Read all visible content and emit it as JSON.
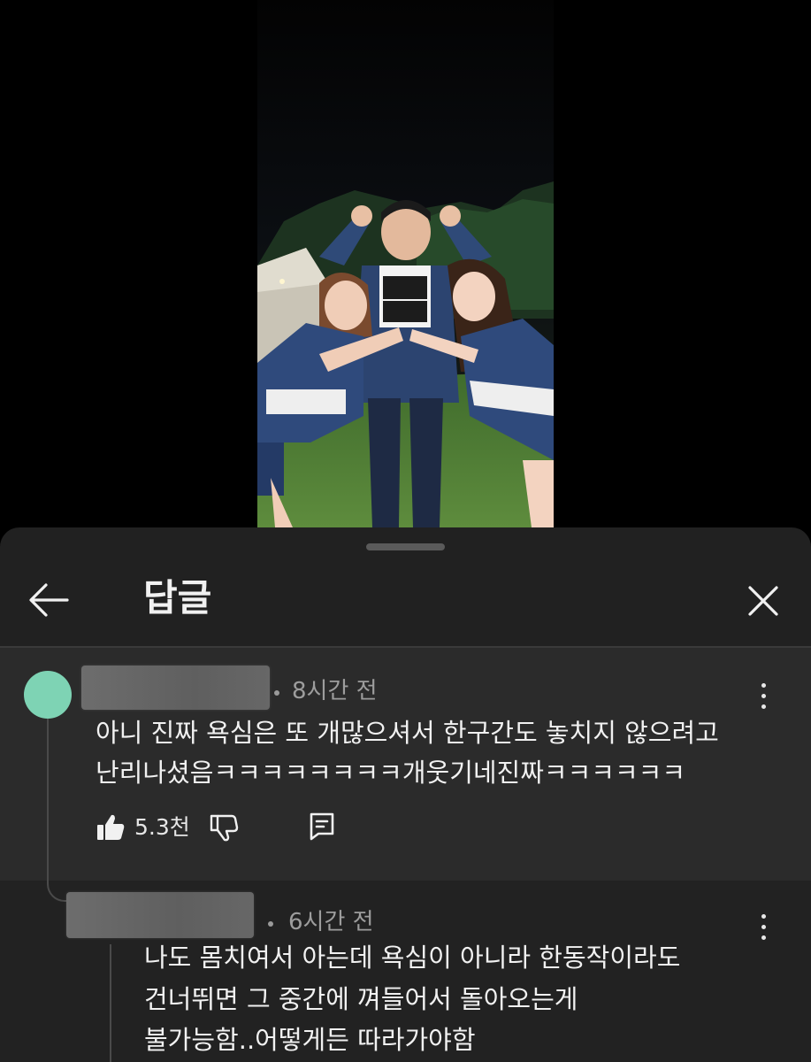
{
  "sheet": {
    "title": "답글",
    "back_icon": "arrow-left-icon",
    "close_icon": "close-icon"
  },
  "parent_comment": {
    "time": "8시간 전",
    "lines": [
      "아니 진짜 욕심은 또 개많으셔서 한구간도 놓치지 않으려고",
      "난리나셨음ㅋㅋㅋㅋㅋㅋㅋㅋ개웃기네진짜ㅋㅋㅋㅋㅋㅋ"
    ],
    "likes": "5.3천",
    "avatar_color": "#7ed3b4"
  },
  "reply_comment": {
    "time": "6시간 전",
    "lines": [
      "나도 몸치여서 아는데 욕심이 아니라 한동작이라도",
      "건너뛰면  그 중간에 껴들어서 돌아오는게",
      "불가능함..어떻게든 따라가야함"
    ]
  },
  "colors": {
    "sheet_bg": "#212121",
    "highlight_bg": "#2b2b2b",
    "text": "#f1f1f1",
    "muted": "#9d9d9d"
  }
}
